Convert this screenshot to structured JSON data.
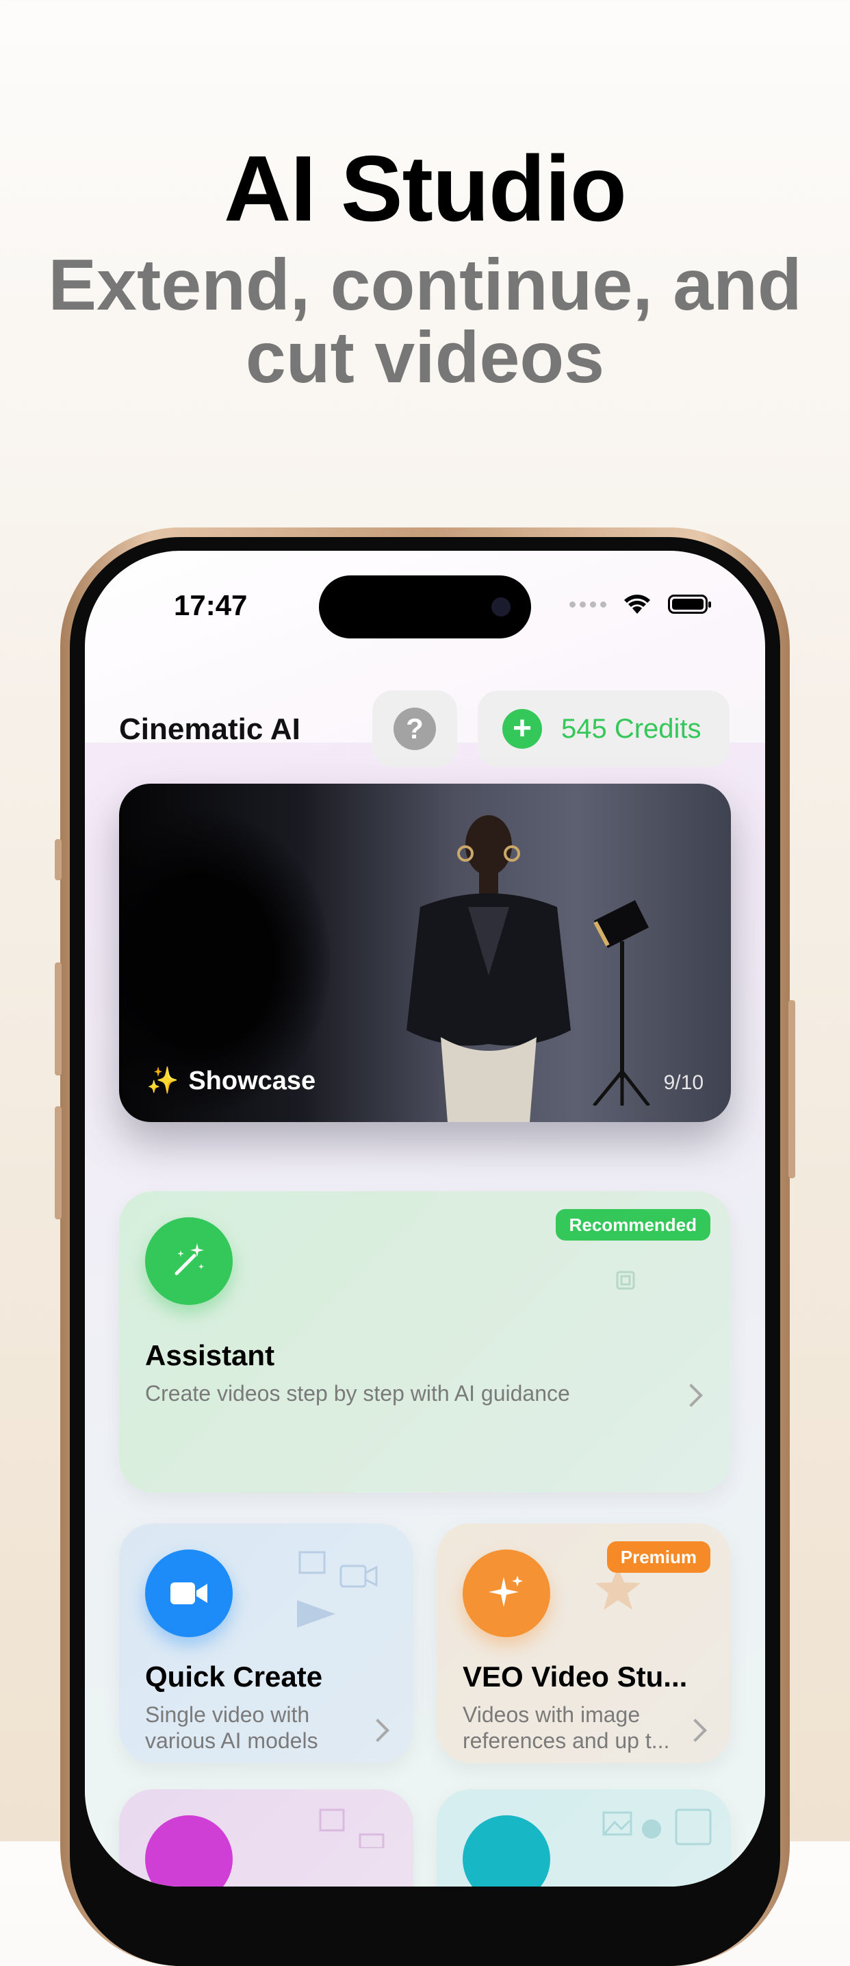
{
  "promo": {
    "title": "AI Studio",
    "subtitle_line1": "Extend, continue, and",
    "subtitle_line2": "cut videos"
  },
  "status_bar": {
    "time": "17:47"
  },
  "header": {
    "app_title": "Cinematic AI",
    "help_symbol": "?",
    "credits_label": "545 Credits",
    "credits_icon": "plus-circle-icon"
  },
  "showcase": {
    "label": "Showcase",
    "counter": "9/10",
    "icon": "sparkles-icon"
  },
  "cards": {
    "assistant": {
      "title": "Assistant",
      "description": "Create videos step by step with AI guidance",
      "badge": "Recommended",
      "icon": "magic-wand-icon",
      "color": "#34c759"
    },
    "quick_create": {
      "title": "Quick Create",
      "description_line1": "Single video with",
      "description_line2": "various AI models",
      "icon": "video-camera-icon",
      "color": "#1d8cf8"
    },
    "veo": {
      "title": "VEO Video Stu...",
      "description_line1": "Videos with image",
      "description_line2": "references and up t...",
      "badge": "Premium",
      "icon": "sparkle-icon",
      "color": "#f59334"
    }
  },
  "colors": {
    "accent_green": "#34c759",
    "accent_blue": "#1d8cf8",
    "accent_orange": "#f59334",
    "premium_orange": "#f58a26"
  }
}
